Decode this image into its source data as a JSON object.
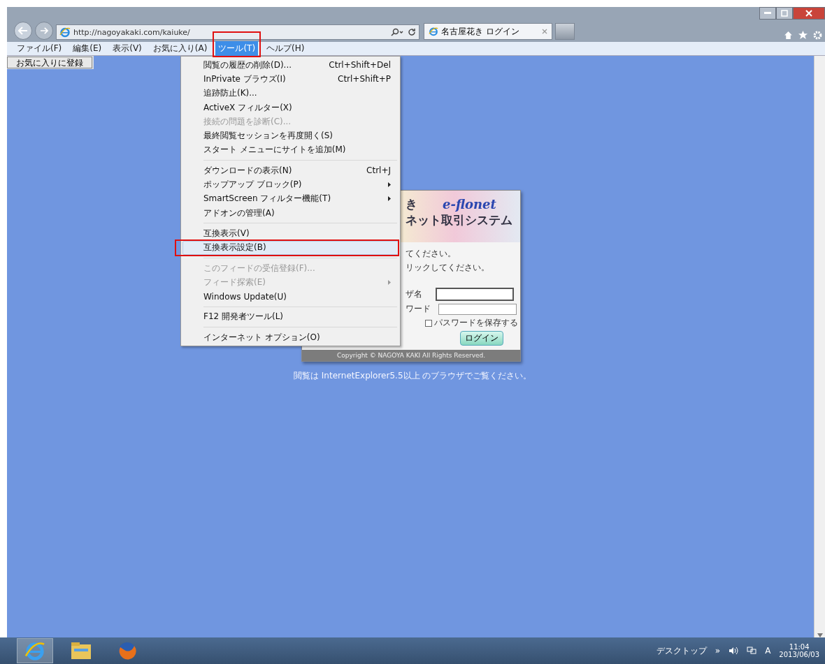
{
  "browser": {
    "address": "http://nagoyakaki.com/kaiuke/",
    "tabs": [
      {
        "title": "名古屋花き ログイン",
        "selected": true
      }
    ]
  },
  "menubar": [
    {
      "label": "ファイル(F)",
      "selected": false
    },
    {
      "label": "編集(E)",
      "selected": false
    },
    {
      "label": "表示(V)",
      "selected": false
    },
    {
      "label": "お気に入り(A)",
      "selected": false
    },
    {
      "label": "ツール(T)",
      "selected": true
    },
    {
      "label": "ヘルプ(H)",
      "selected": false
    }
  ],
  "favorites_button": "お気に入りに登録",
  "tools_menu": [
    [
      {
        "label": "閲覧の履歴の削除(D)...",
        "shortcut": "Ctrl+Shift+Del",
        "disabled": false,
        "submenu": false,
        "selected": false
      },
      {
        "label": "InPrivate ブラウズ(I)",
        "shortcut": "Ctrl+Shift+P",
        "disabled": false,
        "submenu": false,
        "selected": false
      },
      {
        "label": "追跡防止(K)...",
        "disabled": false,
        "submenu": false,
        "selected": false
      },
      {
        "label": "ActiveX フィルター(X)",
        "disabled": false,
        "submenu": false,
        "selected": false
      },
      {
        "label": "接続の問題を診断(C)...",
        "disabled": true,
        "submenu": false,
        "selected": false
      },
      {
        "label": "最終閲覧セッションを再度開く(S)",
        "disabled": false,
        "submenu": false,
        "selected": false
      },
      {
        "label": "スタート メニューにサイトを追加(M)",
        "disabled": false,
        "submenu": false,
        "selected": false
      }
    ],
    [
      {
        "label": "ダウンロードの表示(N)",
        "shortcut": "Ctrl+J",
        "disabled": false,
        "submenu": false,
        "selected": false
      },
      {
        "label": "ポップアップ ブロック(P)",
        "disabled": false,
        "submenu": true,
        "selected": false
      },
      {
        "label": "SmartScreen フィルター機能(T)",
        "disabled": false,
        "submenu": true,
        "selected": false
      },
      {
        "label": "アドオンの管理(A)",
        "disabled": false,
        "submenu": false,
        "selected": false
      }
    ],
    [
      {
        "label": "互換表示(V)",
        "disabled": false,
        "submenu": false,
        "selected": false
      },
      {
        "label": "互換表示設定(B)",
        "disabled": false,
        "submenu": false,
        "selected": true
      }
    ],
    [
      {
        "label": "このフィードの受信登録(F)...",
        "disabled": true,
        "submenu": false,
        "selected": false
      },
      {
        "label": "フィード探索(E)",
        "disabled": true,
        "submenu": true,
        "selected": false
      },
      {
        "label": "Windows Update(U)",
        "disabled": false,
        "submenu": false,
        "selected": false
      }
    ],
    [
      {
        "label": "F12 開発者ツール(L)",
        "disabled": false,
        "submenu": false,
        "selected": false
      }
    ],
    [
      {
        "label": "インターネット オプション(O)",
        "disabled": false,
        "submenu": false,
        "selected": false
      }
    ]
  ],
  "login": {
    "banner": {
      "title_fragment": "き",
      "brand": "e-flonet",
      "subtitle_fragment": "ネット取引システム"
    },
    "instructions": [
      "てください。",
      "リックしてください。"
    ],
    "fields": [
      {
        "label": "ザ名",
        "focused": true
      },
      {
        "label": "ワード",
        "focused": false
      }
    ],
    "save_password": {
      "label": "パスワードを保存する",
      "checked": false
    },
    "button": "ログイン",
    "copyright": "Copyright © NAGOYA KAKI All Rights Reserved."
  },
  "notice": "閲覧は InternetExplorer5.5以上 のブラウザでご覧ください。",
  "taskbar": {
    "desktop": "デスクトップ",
    "overflow": "»",
    "ime": "A",
    "time": "11:04",
    "date": "2013/06/03"
  }
}
